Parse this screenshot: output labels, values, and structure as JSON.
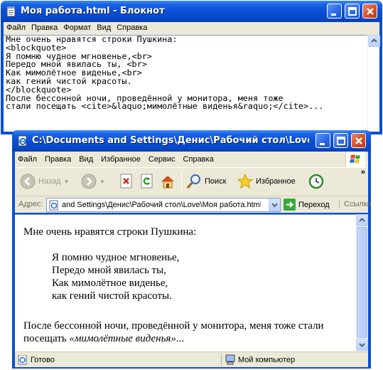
{
  "notepad": {
    "title": "Моя работа.html - Блокнот",
    "menu": [
      "Файл",
      "Правка",
      "Формат",
      "Вид",
      "Справка"
    ],
    "lines": [
      "Мне очень нравятся строки Пушкина:",
      "<blockquote>",
      "Я помню чудное мгновенье,<br>",
      "Передо мной явилась ты, <br>",
      "Как мимолётное виденье,<br>",
      "как гений чистой красоты.",
      "</blockquote>",
      "После бессонной ночи, проведённой у монитора, меня тоже",
      "стали посещать <cite>&laquo;мимолётные виденья&raquo;</cite>...",
      ""
    ]
  },
  "ie": {
    "title": "C:\\Documents and Settings\\Денис\\Рабочий стол\\Love\\Моя ра...",
    "menu": [
      "Файл",
      "Правка",
      "Вид",
      "Избранное",
      "Сервис",
      "Справка"
    ],
    "toolbar": {
      "back": "Назад",
      "search": "Поиск",
      "favorites": "Избранное"
    },
    "address": {
      "label": "Адрес:",
      "value": "and Settings\\Денис\\Рабочий стол\\Love\\Моя работа.html",
      "go": "Переход",
      "links": "Ссылки"
    },
    "content": {
      "intro": "Мне очень нравятся строки Пушкина:",
      "poem": [
        "Я помню чудное мгновенье,",
        "Передо мной явилась ты,",
        "Как мимолётное виденье,",
        "как гений чистой красоты."
      ],
      "after_1": "После бессонной ночи, проведённой у монитора, меня тоже стали",
      "after_2_prefix": "посещать ",
      "cite": "«мимолётные виденья»",
      "after_2_suffix": "..."
    },
    "status": {
      "left": "Готово",
      "zone": "Мой компьютер"
    }
  },
  "colors": {
    "titlebar": "#0a4fd6",
    "chrome": "#ece9d8",
    "close_button": "#d9502a"
  },
  "icons": [
    "notepad-icon",
    "ie-icon",
    "back-icon",
    "forward-icon",
    "stop-icon",
    "refresh-icon",
    "home-icon",
    "search-icon",
    "favorites-icon",
    "history-icon",
    "windows-flag-icon",
    "go-icon",
    "computer-icon",
    "page-icon"
  ]
}
